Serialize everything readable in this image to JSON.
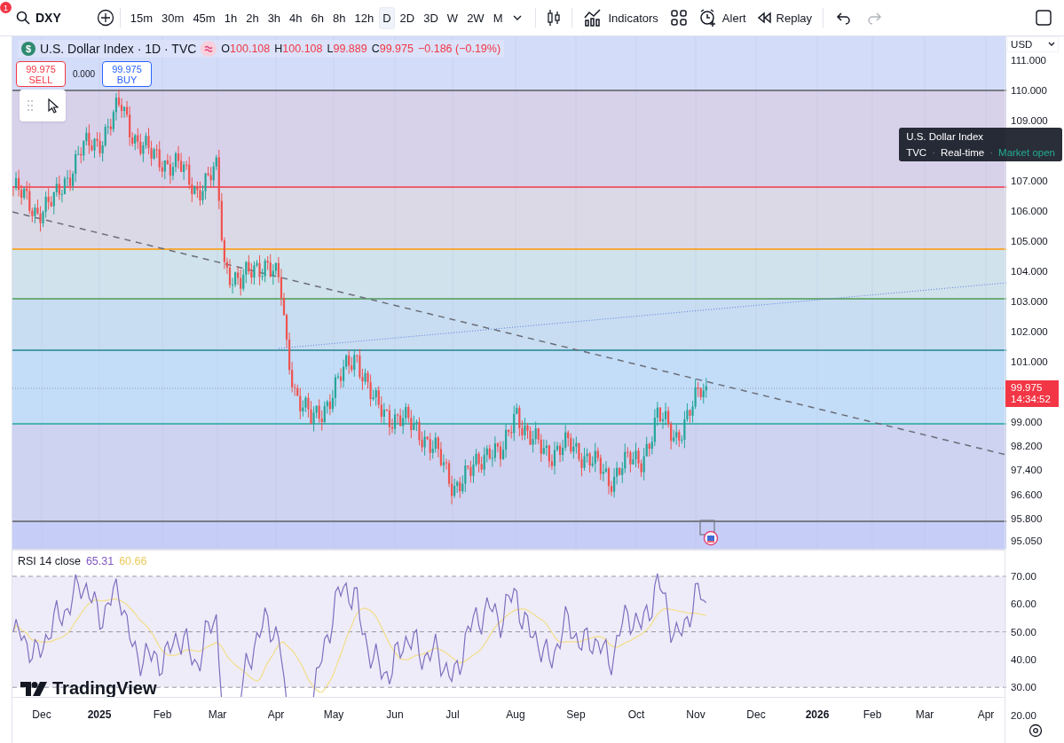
{
  "toolbar": {
    "notification_badge": "1",
    "symbol": "DXY",
    "intervals": [
      {
        "label": "15m",
        "selected": false
      },
      {
        "label": "30m",
        "selected": false
      },
      {
        "label": "45m",
        "selected": false
      },
      {
        "label": "1h",
        "selected": false
      },
      {
        "label": "2h",
        "selected": false
      },
      {
        "label": "3h",
        "selected": false
      },
      {
        "label": "4h",
        "selected": false
      },
      {
        "label": "6h",
        "selected": false
      },
      {
        "label": "8h",
        "selected": false
      },
      {
        "label": "12h",
        "selected": false
      },
      {
        "label": "D",
        "selected": true
      },
      {
        "label": "2D",
        "selected": false
      },
      {
        "label": "3D",
        "selected": false
      },
      {
        "label": "W",
        "selected": false
      },
      {
        "label": "2W",
        "selected": false
      },
      {
        "label": "M",
        "selected": false
      }
    ],
    "buttons": [
      {
        "kind": "indicators",
        "label": "Indicators"
      },
      {
        "kind": "templates"
      },
      {
        "kind": "alert",
        "label": "Alert"
      },
      {
        "kind": "replay",
        "label": "Replay"
      }
    ],
    "history": [
      {
        "kind": "undo",
        "disabled": false
      },
      {
        "kind": "redo",
        "disabled": true
      }
    ]
  },
  "legend": {
    "logo_glyph": "$",
    "title": "U.S. Dollar Index · 1D · TVC",
    "ohlc": [
      {
        "key": "O",
        "value": "100.108"
      },
      {
        "key": "H",
        "value": "100.108"
      },
      {
        "key": "L",
        "value": "99.889"
      },
      {
        "key": "C",
        "value": "99.975"
      }
    ],
    "change": "−0.186 (−0.19%)"
  },
  "trade": {
    "sell_price": "99.975",
    "sell_label": "SELL",
    "spread": "0.000",
    "buy_price": "99.975",
    "buy_label": "BUY"
  },
  "currency": "USD",
  "price_axis": [
    "111.000",
    "110.000",
    "109.000",
    "107.000",
    "106.000",
    "105.000",
    "104.000",
    "103.000",
    "102.000",
    "101.000",
    "99.000",
    "98.200",
    "97.400",
    "96.600",
    "95.800",
    "95.050"
  ],
  "price_label": {
    "price": "99.975",
    "countdown": "14:34:52"
  },
  "tooltip": {
    "title": "U.S. Dollar Index",
    "details": [
      {
        "kind": "text",
        "text": "TVC"
      },
      {
        "kind": "separator",
        "text": "·"
      },
      {
        "kind": "text",
        "text": "Real-time"
      },
      {
        "kind": "separator",
        "text": "·"
      },
      {
        "kind": "status",
        "text": "Market open"
      }
    ]
  },
  "rsi": {
    "label": "RSI 14 close",
    "value": "65.31",
    "ma_value": "60.66",
    "axis": [
      "70.00",
      "60.00",
      "50.00",
      "40.00",
      "30.00",
      "20.00"
    ]
  },
  "brand": "TradingView",
  "time_axis": [
    {
      "label": "Dec",
      "bold": false
    },
    {
      "label": "2025",
      "bold": true
    },
    {
      "label": "Feb",
      "bold": false
    },
    {
      "label": "Mar",
      "bold": false
    },
    {
      "label": "Apr",
      "bold": false
    },
    {
      "label": "May",
      "bold": false
    },
    {
      "label": "Jun",
      "bold": false
    },
    {
      "label": "Jul",
      "bold": false
    },
    {
      "label": "Aug",
      "bold": false
    },
    {
      "label": "Sep",
      "bold": false
    },
    {
      "label": "Oct",
      "bold": false
    },
    {
      "label": "Nov",
      "bold": false
    },
    {
      "label": "Dec",
      "bold": false
    },
    {
      "label": "2026",
      "bold": true
    },
    {
      "label": "Feb",
      "bold": false
    },
    {
      "label": "Mar",
      "bold": false
    },
    {
      "label": "Apr",
      "bold": false
    }
  ]
}
